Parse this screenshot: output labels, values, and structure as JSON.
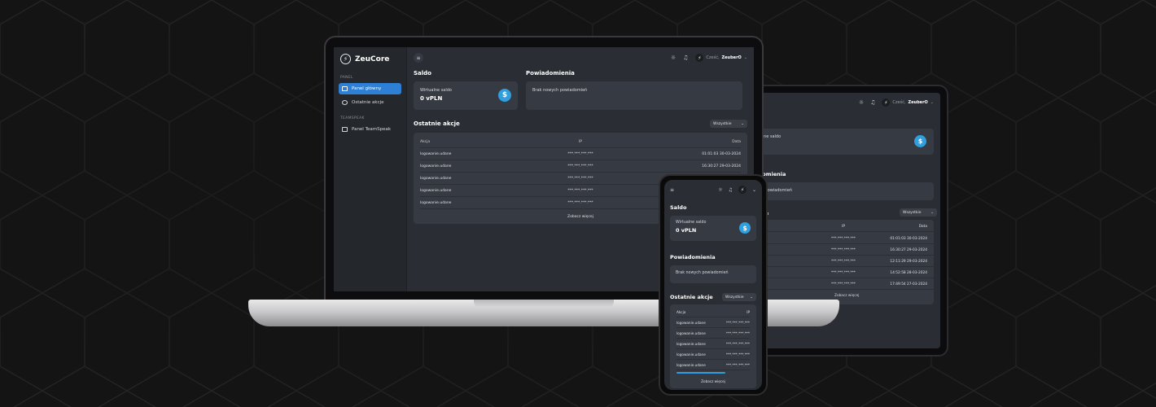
{
  "brand": {
    "name": "ZeuCore"
  },
  "topbar": {
    "greeting": "Cześć,",
    "username": "ZeuberO"
  },
  "sidebar": {
    "sections": [
      {
        "label": "PANEL",
        "items": [
          {
            "label": "Panel główny",
            "active": true
          },
          {
            "label": "Ostatnie akcje",
            "active": false
          }
        ]
      },
      {
        "label": "TEAMSPEAK",
        "items": [
          {
            "label": "Panel TeamSpeak",
            "active": false
          }
        ]
      }
    ]
  },
  "saldo": {
    "title": "Saldo",
    "label": "Wirtualne saldo",
    "value": "0 vPLN",
    "icon": "dollar-icon"
  },
  "notifications": {
    "title": "Powiadomienia",
    "empty_text": "Brak nowych powiadomień"
  },
  "actions": {
    "title": "Ostatnie akcje",
    "filter": "Wszystkie",
    "columns": [
      "Akcja",
      "IP",
      "Data"
    ],
    "rows": [
      {
        "action": "logowanie.udane",
        "ip": "***.***.***.***",
        "date": "01:01:03 30-03-2024"
      },
      {
        "action": "logowanie.udane",
        "ip": "***.***.***.***",
        "date": "16:30:27 29-03-2024"
      },
      {
        "action": "logowanie.udane",
        "ip": "***.***.***.***",
        "date": ""
      },
      {
        "action": "logowanie.udane",
        "ip": "***.***.***.***",
        "date": ""
      },
      {
        "action": "logowanie.udane",
        "ip": "***.***.***.***",
        "date": ""
      }
    ],
    "more_label": "Zobacz więcej"
  },
  "tablet": {
    "saldo_label": "irtualne saldo",
    "saldo_value": "LN",
    "notifications_title": "iadomienia",
    "notifications_text": "wych powiadomień",
    "actions_title": "akcje",
    "filter": "Wszystkie",
    "columns": [
      "",
      "IP",
      "Data"
    ],
    "rows": [
      {
        "action": "udane",
        "ip": "***.***.***.***",
        "date": "01:01:03 30-03-2024"
      },
      {
        "action": "udane",
        "ip": "***.***.***.***",
        "date": "16:30:27 29-03-2024"
      },
      {
        "action": "udane",
        "ip": "***.***.***.***",
        "date": "12:11:29 29-03-2024"
      },
      {
        "action": "udane",
        "ip": "***.***.***.***",
        "date": "14:52:58 28-03-2024"
      },
      {
        "action": "udane",
        "ip": "***.***.***.***",
        "date": "17:49:54 27-03-2024"
      }
    ],
    "more_label": "Zobacz więcej"
  },
  "phone": {
    "columns": [
      "Akcja",
      "IP"
    ],
    "rows": [
      {
        "action": "logowanie.udane",
        "ip": "***.***.***.***"
      },
      {
        "action": "logowanie.udane",
        "ip": "***.***.***.***"
      },
      {
        "action": "logowanie.udane",
        "ip": "***.***.***.***"
      },
      {
        "action": "logowanie.udane",
        "ip": "***.***.***.***"
      },
      {
        "action": "logowanie.udane",
        "ip": "***.***.***.***"
      }
    ],
    "more_label": "Zobacz więcej"
  },
  "colors": {
    "accent": "#2e7fd6",
    "dollar": "#2f9fe0",
    "bg": "#141414",
    "panel": "#2a2d33",
    "card": "#363a42"
  }
}
